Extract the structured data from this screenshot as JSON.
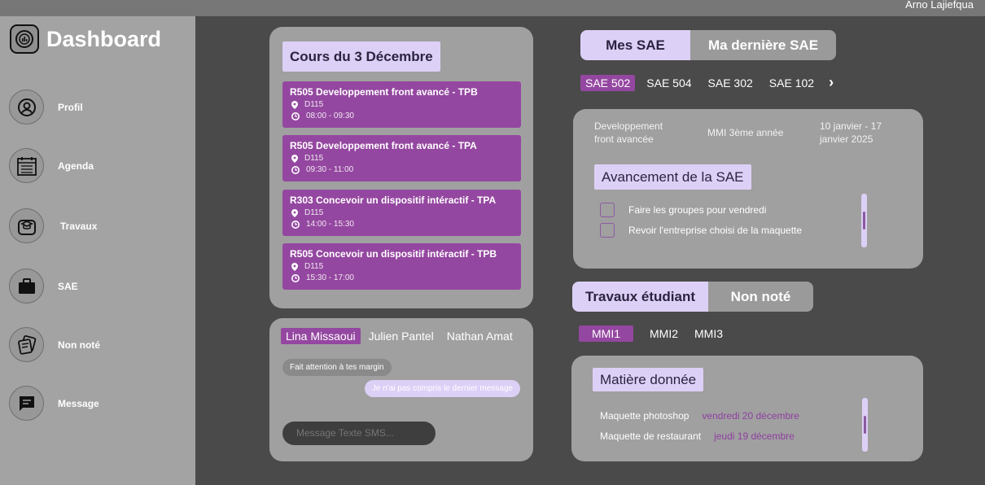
{
  "header": {
    "user_name": "Arno Lajiefqua"
  },
  "sidebar": {
    "app_title": "Dashboard",
    "items": [
      {
        "label": "Profil",
        "icon": "user-circle-icon"
      },
      {
        "label": "Agenda",
        "icon": "calendar-icon"
      },
      {
        "label": "Travaux",
        "icon": "graduation-cap-icon"
      },
      {
        "label": "SAE",
        "icon": "briefcase-icon"
      },
      {
        "label": "Non noté",
        "icon": "notes-icon"
      },
      {
        "label": "Message",
        "icon": "message-icon"
      }
    ]
  },
  "courses": {
    "title": "Cours du 3 Décembre",
    "items": [
      {
        "title": "R505 Developpement front avancé - TPB",
        "room": "D115",
        "time": "08:00 - 09:30"
      },
      {
        "title": "R505 Developpement front avancé - TPA",
        "room": "D115",
        "time": "09:30 - 11:00"
      },
      {
        "title": "R303 Concevoir un dispositif intéractif - TPA",
        "room": "D115",
        "time": "14:00 - 15:30"
      },
      {
        "title": "R505 Concevoir un dispositif intéractif - TPB",
        "room": "D115",
        "time": "15:30 - 17:00"
      }
    ]
  },
  "chat": {
    "contacts": [
      "Lina Missaoui",
      "Julien Pantel",
      "Nathan Amat"
    ],
    "incoming": "Fait attention à tes margin",
    "outgoing": "Je n'ai pas compris le dernier message",
    "input_placeholder": "Message Texte SMS..."
  },
  "sae": {
    "tabs": [
      "Mes SAE",
      "Ma dernière SAE"
    ],
    "codes": [
      "SAE 502",
      "SAE 504",
      "SAE 302",
      "SAE 102"
    ],
    "next_label": "›",
    "subject": "Developpement front avancée",
    "level": "MMI 3ème année",
    "dates": "10 janvier - 17 janvier 2025",
    "progress_title": "Avancement de la SAE",
    "tasks": [
      "Faire les groupes pour vendredi",
      "Revoir l'entreprise choisi de la maquette"
    ]
  },
  "travaux": {
    "tabs": [
      "Travaux étudiant",
      "Non noté"
    ],
    "classes": [
      "MMI1",
      "MMI2",
      "MMI3"
    ],
    "title": "Matière donnée",
    "items": [
      {
        "name": "Maquette photoshop",
        "date": "vendredi 20 décembre"
      },
      {
        "name": "Maquette de restaurant",
        "date": "jeudi 19 décembre"
      }
    ]
  },
  "colors": {
    "accent": "#9447a0",
    "accent_light": "#ddd0f6",
    "sidebar": "#a3a3a3",
    "background": "#4a4a4a",
    "card": "#a0a0a0"
  }
}
